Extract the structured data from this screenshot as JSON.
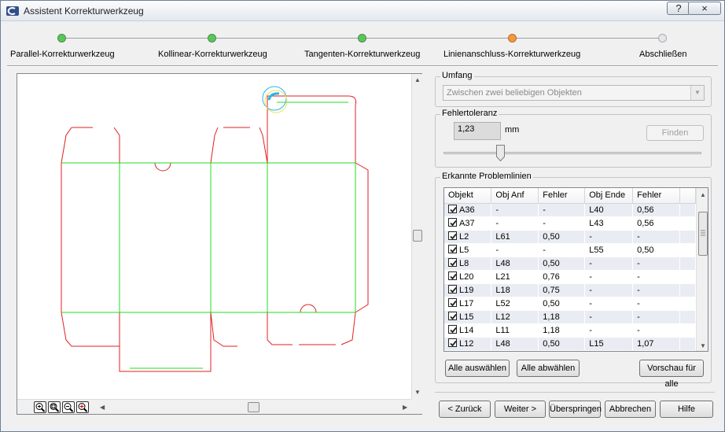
{
  "window": {
    "title": "Assistent Korrekturwerkzeug",
    "help_label": "?",
    "close_label": "×"
  },
  "steps": [
    {
      "label": "Parallel-Korrekturwerkzeug",
      "state": "done",
      "color": "#5cc45c"
    },
    {
      "label": "Kollinear-Korrekturwerkzeug",
      "state": "done",
      "color": "#5cc45c"
    },
    {
      "label": "Tangenten-Korrekturwerkzeug",
      "state": "done",
      "color": "#5cc45c"
    },
    {
      "label": "Linienanschluss-Korrekturwerkzeug",
      "state": "active",
      "color": "#f5973b"
    },
    {
      "label": "Abschließen",
      "state": "pending",
      "color": "#e4e6ea"
    }
  ],
  "canvas": {
    "zoom_icons": [
      "zoom-in-icon",
      "zoom-window-icon",
      "zoom-out-icon",
      "zoom-fit-icon"
    ],
    "cut_line_color": "#e02020",
    "crease_line_color": "#22dd22",
    "highlight_color": "#22b8e8"
  },
  "umfang": {
    "legend": "Umfang",
    "selected": "Zwischen zwei beliebigen Objekten"
  },
  "tolerance": {
    "legend": "Fehlertoleranz",
    "value": "1,23",
    "unit": "mm",
    "find_label": "Finden",
    "slider_fraction": 0.22
  },
  "problems": {
    "legend": "Erkannte Problemlinien",
    "columns": [
      "Objekt",
      "Obj Anf",
      "Fehler",
      "Obj Ende",
      "Fehler"
    ],
    "rows": [
      {
        "obj": "A36",
        "start": "-",
        "err1": "-",
        "end": "L40",
        "err2": "0,56"
      },
      {
        "obj": "A37",
        "start": "-",
        "err1": "-",
        "end": "L43",
        "err2": "0,56"
      },
      {
        "obj": "L2",
        "start": "L61",
        "err1": "0,50",
        "end": "-",
        "err2": "-"
      },
      {
        "obj": "L5",
        "start": "-",
        "err1": "-",
        "end": "L55",
        "err2": "0,50"
      },
      {
        "obj": "L8",
        "start": "L48",
        "err1": "0,50",
        "end": "-",
        "err2": "-"
      },
      {
        "obj": "L20",
        "start": "L21",
        "err1": "0,76",
        "end": "-",
        "err2": "-"
      },
      {
        "obj": "L19",
        "start": "L18",
        "err1": "0,75",
        "end": "-",
        "err2": "-"
      },
      {
        "obj": "L17",
        "start": "L52",
        "err1": "0,50",
        "end": "-",
        "err2": "-"
      },
      {
        "obj": "L15",
        "start": "L12",
        "err1": "1,18",
        "end": "-",
        "err2": "-"
      },
      {
        "obj": "L14",
        "start": "L11",
        "err1": "1,18",
        "end": "-",
        "err2": "-"
      },
      {
        "obj": "L12",
        "start": "L48",
        "err1": "0,50",
        "end": "L15",
        "err2": "1,07"
      }
    ],
    "select_all_label": "Alle auswählen",
    "deselect_all_label": "Alle abwählen",
    "preview_all_label": "Vorschau für alle"
  },
  "footer": {
    "back_label": "< Zurück",
    "next_label": "Weiter >",
    "skip_label": "Überspringen",
    "cancel_label": "Abbrechen",
    "help_label": "Hilfe"
  }
}
